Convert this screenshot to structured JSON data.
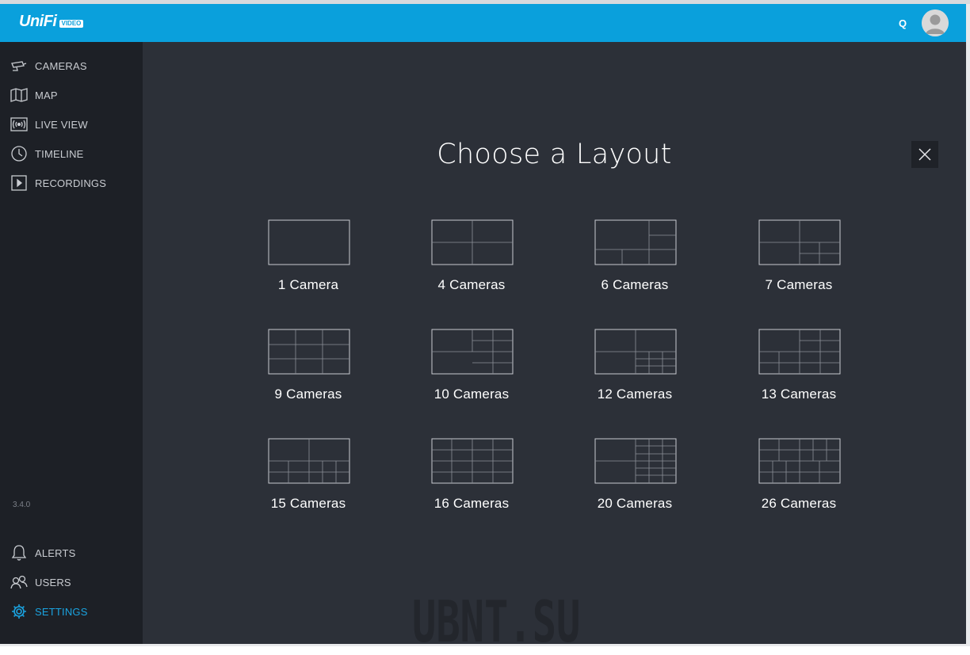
{
  "header": {
    "logo_text": "UniFi",
    "logo_badge": "VIDEO",
    "search_label": "Q",
    "accent_color": "#0aa0dc"
  },
  "sidebar": {
    "items": [
      {
        "label": "CAMERAS",
        "icon": "camera-icon"
      },
      {
        "label": "MAP",
        "icon": "map-icon"
      },
      {
        "label": "LIVE VIEW",
        "icon": "live-view-icon"
      },
      {
        "label": "TIMELINE",
        "icon": "clock-icon"
      },
      {
        "label": "RECORDINGS",
        "icon": "play-icon"
      }
    ],
    "version": "3.4.0",
    "bottom_items": [
      {
        "label": "ALERTS",
        "icon": "bell-icon"
      },
      {
        "label": "USERS",
        "icon": "users-icon"
      },
      {
        "label": "SETTINGS",
        "icon": "gear-icon",
        "active": true
      }
    ],
    "active_color": "#1aa3e0"
  },
  "main": {
    "title": "Choose a Layout",
    "close_icon": "close-icon",
    "layouts": [
      {
        "label": "1 Camera"
      },
      {
        "label": "4 Cameras"
      },
      {
        "label": "6 Cameras"
      },
      {
        "label": "7 Cameras"
      },
      {
        "label": "9 Cameras"
      },
      {
        "label": "10 Cameras"
      },
      {
        "label": "12 Cameras"
      },
      {
        "label": "13 Cameras"
      },
      {
        "label": "15 Cameras"
      },
      {
        "label": "16 Cameras"
      },
      {
        "label": "20 Cameras"
      },
      {
        "label": "26 Cameras"
      }
    ]
  },
  "watermark": "UBNT.SU"
}
